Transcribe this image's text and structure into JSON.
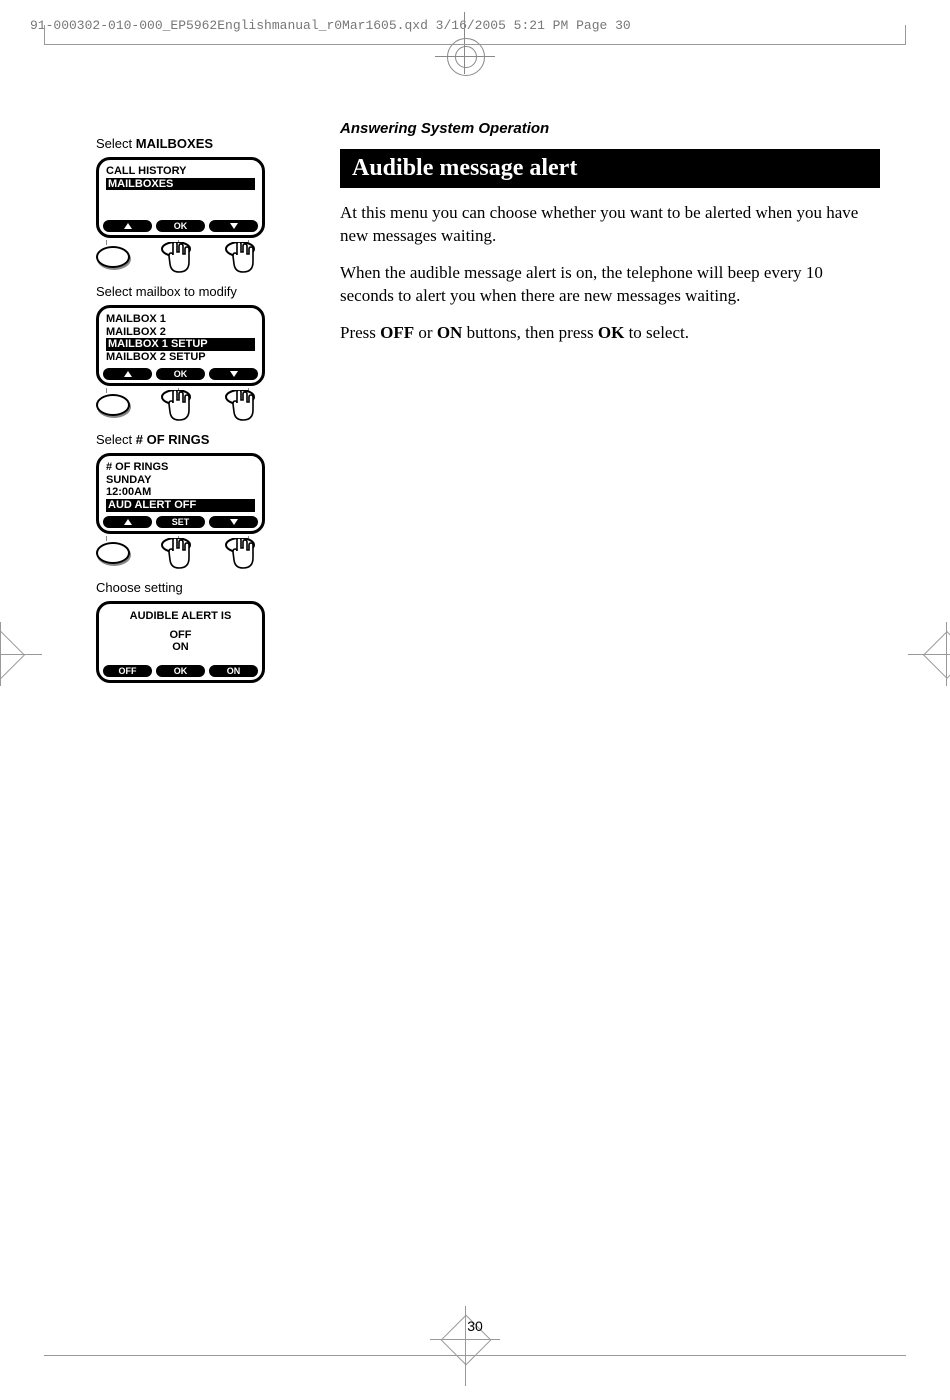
{
  "header": "91-000302-010-000_EP5962Englishmanual_r0Mar1605.qxd  3/16/2005  5:21 PM  Page 30",
  "section_label": "Answering System Operation",
  "banner": "Audible message alert",
  "para1": "At this menu you can choose whether you want to be alerted when you have new messages waiting.",
  "para2": "When the audible message alert is on, the telephone will beep every 10 seconds to alert you when there are new messages waiting.",
  "para3_pre": "Press ",
  "para3_b1": "OFF",
  "para3_mid1": " or ",
  "para3_b2": "ON",
  "para3_mid2": " buttons, then press ",
  "para3_b3": "OK",
  "para3_post": " to select.",
  "side": {
    "c1_pre": "Select ",
    "c1_b": "MAILBOXES",
    "s1_l1": "CALL HISTORY",
    "s1_l2": "MAILBOXES",
    "sk_ok": "OK",
    "c2": "Select mailbox to modify",
    "s2_l1_pre": "MAILBOX ",
    "s2_l1_b": "1",
    "s2_l2_pre": "MAILBOX ",
    "s2_l2_b": "2",
    "s2_l3_pre": "MAILBOX ",
    "s2_l3_b": "1",
    "s2_l3_post": " SETUP",
    "s2_l4_pre": "MAILBOX ",
    "s2_l4_b": "2",
    "s2_l4_post": " SETUP",
    "c3_pre": "Select ",
    "c3_b": "# OF RINGS",
    "s3_l1": "# OF RINGS",
    "s3_l2": "SUNDAY",
    "s3_l3": "12:00AM",
    "s3_l4": "AUD ALERT OFF",
    "sk_set": "SET",
    "c4": "Choose setting",
    "s4_title": "AUDIBLE ALERT IS",
    "s4_opt1": "OFF",
    "s4_opt2": "ON",
    "sk_off": "OFF",
    "sk_on": "ON"
  },
  "page_number": "30"
}
